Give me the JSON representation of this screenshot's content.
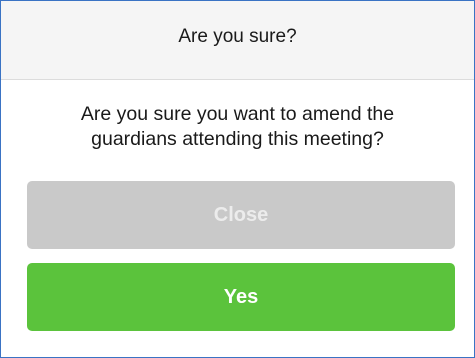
{
  "dialog": {
    "title": "Are you sure?",
    "message": "Are you sure you want to amend the guardians attending this meeting?",
    "close_label": "Close",
    "yes_label": "Yes"
  },
  "colors": {
    "header_bg": "#f5f5f5",
    "close_bg": "#c9c9c9",
    "yes_bg": "#5bc33c",
    "border": "#3a73c4"
  }
}
